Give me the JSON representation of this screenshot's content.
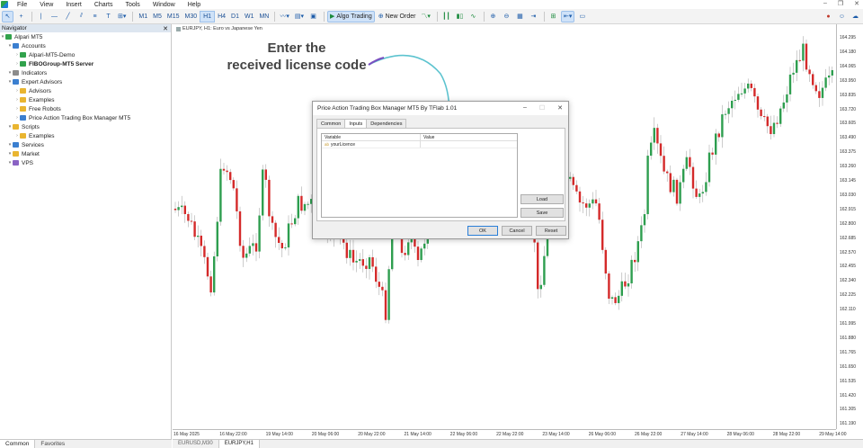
{
  "menu": [
    "File",
    "View",
    "Insert",
    "Charts",
    "Tools",
    "Window",
    "Help"
  ],
  "toolbar": {
    "timeframes": [
      "M1",
      "M5",
      "M15",
      "M30",
      "H1",
      "H4",
      "D1",
      "W1",
      "MN"
    ],
    "active_timeframe": "H1",
    "algo_trading": "Algo Trading",
    "new_order": "New Order"
  },
  "navigator": {
    "title": "Navigator",
    "items": [
      {
        "label": "Alpari MT5",
        "indent": 0,
        "icon": "green",
        "bold": false
      },
      {
        "label": "Accounts",
        "indent": 1,
        "icon": "blue",
        "bold": false
      },
      {
        "label": "Alpari-MT5-Demo",
        "indent": 2,
        "icon": "green",
        "bold": false
      },
      {
        "label": "FIBOGroup-MT5 Server",
        "indent": 2,
        "icon": "green",
        "bold": true
      },
      {
        "label": "Indicators",
        "indent": 1,
        "icon": "grey",
        "bold": false
      },
      {
        "label": "Expert Advisors",
        "indent": 1,
        "icon": "blue",
        "bold": false
      },
      {
        "label": "Advisors",
        "indent": 2,
        "icon": "folder",
        "bold": false
      },
      {
        "label": "Examples",
        "indent": 2,
        "icon": "folder",
        "bold": false
      },
      {
        "label": "Free Robots",
        "indent": 2,
        "icon": "folder",
        "bold": false
      },
      {
        "label": "Price Action Trading Box Manager MT5",
        "indent": 2,
        "icon": "blue",
        "bold": false
      },
      {
        "label": "Scripts",
        "indent": 1,
        "icon": "folder",
        "bold": false
      },
      {
        "label": "Examples",
        "indent": 2,
        "icon": "folder",
        "bold": false
      },
      {
        "label": "Services",
        "indent": 1,
        "icon": "blue",
        "bold": false
      },
      {
        "label": "Market",
        "indent": 1,
        "icon": "folder",
        "bold": false
      },
      {
        "label": "VPS",
        "indent": 1,
        "icon": "purple",
        "bold": false
      }
    ],
    "tabs": [
      "Common",
      "Favorites"
    ]
  },
  "chart": {
    "header": "EURJPY, H1:  Euro vs Japanese Yen",
    "price_labels": [
      "164.295",
      "164.180",
      "164.065",
      "163.950",
      "163.835",
      "163.720",
      "163.605",
      "163.490",
      "163.375",
      "163.260",
      "163.145",
      "163.030",
      "162.915",
      "162.800",
      "162.685",
      "162.570",
      "162.455",
      "162.340",
      "162.225",
      "162.110",
      "161.995",
      "161.880",
      "161.765",
      "161.650",
      "161.535",
      "161.420",
      "161.305",
      "161.190"
    ],
    "time_labels": [
      "16 May 2025",
      "16 May 22:00",
      "19 May 14:00",
      "20 May 06:00",
      "20 May 22:00",
      "21 May 14:00",
      "22 May 06:00",
      "22 May 22:00",
      "23 May 14:00",
      "26 May 06:00",
      "26 May 22:00",
      "27 May 14:00",
      "28 May 06:00",
      "28 May 22:00",
      "29 May 14:00"
    ],
    "tabs": [
      "EURUSD,M30",
      "EURJPY,H1"
    ],
    "active_tab": "EURJPY,H1"
  },
  "annotation": {
    "line1": "Enter the",
    "line2": "received license code"
  },
  "dialog": {
    "title": "Price Action Trading Box Manager MT5 By TFlab 1.01",
    "tabs": [
      "Common",
      "Inputs",
      "Dependencies"
    ],
    "active_tab": "Inputs",
    "columns": [
      "Variable",
      "Value"
    ],
    "rows": [
      {
        "variable": "yourLicence",
        "value": ""
      }
    ],
    "buttons": {
      "load": "Load",
      "save": "Save",
      "ok": "OK",
      "cancel": "Cancel",
      "reset": "Reset"
    }
  }
}
